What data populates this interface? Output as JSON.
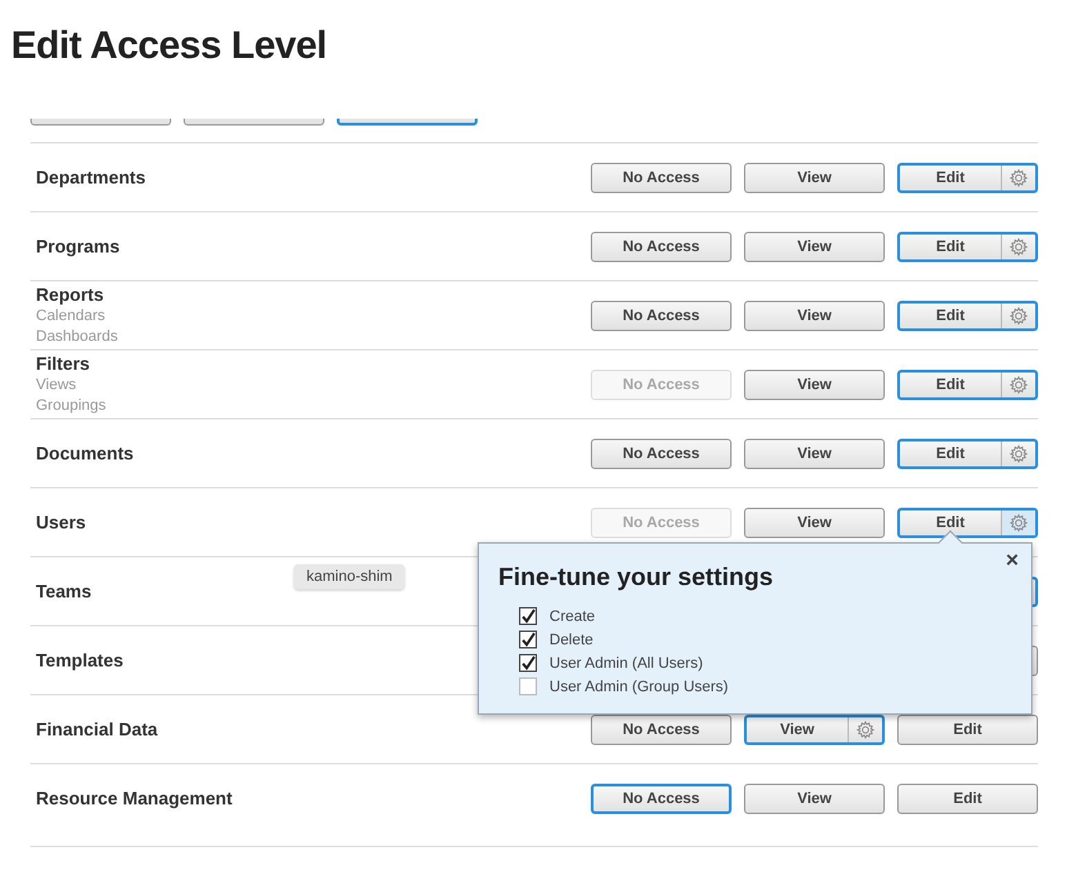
{
  "title": "Edit Access Level",
  "clipped_row": {
    "options": [
      {
        "selected": false
      },
      {
        "selected": false
      },
      {
        "selected": true
      }
    ]
  },
  "rows": [
    {
      "name": "Departments",
      "options": [
        {
          "label": "No Access",
          "selected": false,
          "disabled": false
        },
        {
          "label": "View",
          "selected": false,
          "disabled": false
        },
        {
          "label": "Edit",
          "selected": true,
          "disabled": false
        }
      ]
    },
    {
      "name": "Programs",
      "options": [
        {
          "label": "No Access",
          "selected": false,
          "disabled": false
        },
        {
          "label": "View",
          "selected": false,
          "disabled": false
        },
        {
          "label": "Edit",
          "selected": true,
          "disabled": false
        }
      ]
    },
    {
      "name": "Reports",
      "subitems": [
        "Calendars",
        "Dashboards"
      ],
      "options": [
        {
          "label": "No Access",
          "selected": false,
          "disabled": false
        },
        {
          "label": "View",
          "selected": false,
          "disabled": false
        },
        {
          "label": "Edit",
          "selected": true,
          "disabled": false
        }
      ]
    },
    {
      "name": "Filters",
      "subitems": [
        "Views",
        "Groupings"
      ],
      "options": [
        {
          "label": "No Access",
          "selected": false,
          "disabled": true
        },
        {
          "label": "View",
          "selected": false,
          "disabled": false
        },
        {
          "label": "Edit",
          "selected": true,
          "disabled": false
        }
      ]
    },
    {
      "name": "Documents",
      "options": [
        {
          "label": "No Access",
          "selected": false,
          "disabled": false
        },
        {
          "label": "View",
          "selected": false,
          "disabled": false
        },
        {
          "label": "Edit",
          "selected": true,
          "disabled": false
        }
      ]
    },
    {
      "name": "Users",
      "options": [
        {
          "label": "No Access",
          "selected": false,
          "disabled": true
        },
        {
          "label": "View",
          "selected": false,
          "disabled": false
        },
        {
          "label": "Edit",
          "selected": true,
          "disabled": false,
          "gear_active": true
        }
      ]
    },
    {
      "name": "Teams",
      "options": [
        {
          "selected": true
        }
      ]
    },
    {
      "name": "Templates",
      "options": [
        {
          "selected": false
        }
      ]
    },
    {
      "name": "Financial Data",
      "options": [
        {
          "label": "No Access",
          "selected": false,
          "disabled": false
        },
        {
          "label": "View",
          "selected": true,
          "disabled": false
        },
        {
          "label": "Edit",
          "selected": false,
          "disabled": false
        }
      ]
    },
    {
      "name": "Resource Management",
      "options": [
        {
          "label": "No Access",
          "selected": true,
          "disabled": false,
          "nogear": true
        },
        {
          "label": "View",
          "selected": false,
          "disabled": false
        },
        {
          "label": "Edit",
          "selected": false,
          "disabled": false
        }
      ]
    }
  ],
  "tooltip": "kamino-shim",
  "popover": {
    "title": "Fine-tune your settings",
    "close": "×",
    "options": [
      {
        "label": "Create",
        "checked": true
      },
      {
        "label": "Delete",
        "checked": true
      },
      {
        "label": "User Admin (All Users)",
        "checked": true
      },
      {
        "label": "User Admin (Group Users)",
        "checked": false
      }
    ]
  }
}
